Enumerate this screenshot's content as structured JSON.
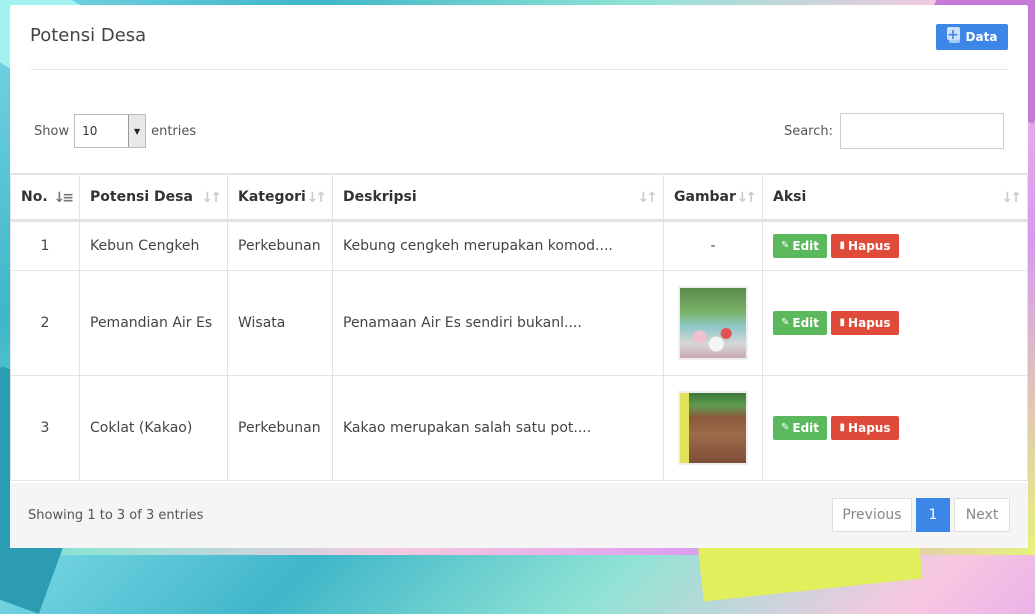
{
  "panel": {
    "title": "Potensi Desa",
    "add_button_label": "Data"
  },
  "controls": {
    "show_label": "Show",
    "entries_value": "10",
    "entries_label": "entries",
    "search_label": "Search:",
    "search_value": ""
  },
  "table": {
    "headers": [
      "No.",
      "Potensi Desa",
      "Kategori",
      "Deskripsi",
      "Gambar",
      "Aksi"
    ],
    "rows": [
      {
        "no": "1",
        "potensi": "Kebun Cengkeh",
        "kategori": "Perkebunan",
        "deskripsi": "Kebung cengkeh merupakan komod....",
        "gambar": "-"
      },
      {
        "no": "2",
        "potensi": "Pemandian Air Es",
        "kategori": "Wisata",
        "deskripsi": "Penamaan Air Es sendiri bukanl....",
        "gambar": ""
      },
      {
        "no": "3",
        "potensi": "Coklat (Kakao)",
        "kategori": "Perkebunan",
        "deskripsi": "Kakao merupakan salah satu pot....",
        "gambar": ""
      }
    ],
    "edit_label": "Edit",
    "delete_label": "Hapus"
  },
  "footer": {
    "info": "Showing 1 to 3 of 3 entries",
    "prev_label": "Previous",
    "current_page": "1",
    "next_label": "Next"
  },
  "colors": {
    "primary": "#3b86e6",
    "edit": "#5cb85c",
    "delete": "#e04a3b"
  }
}
